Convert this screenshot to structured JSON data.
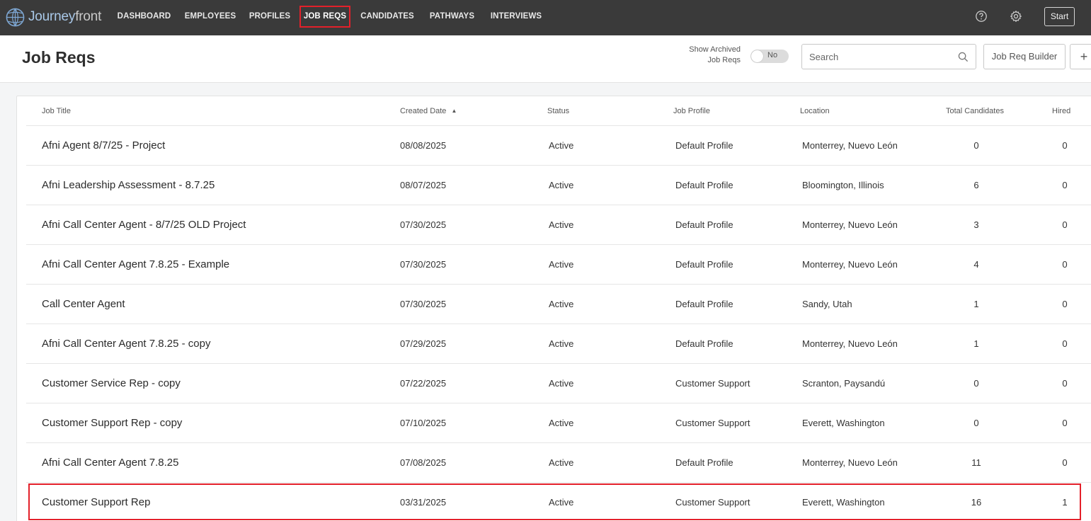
{
  "app": {
    "logo_primary": "Journey",
    "logo_secondary": "front"
  },
  "nav": {
    "items": [
      {
        "label": "DASHBOARD"
      },
      {
        "label": "EMPLOYEES"
      },
      {
        "label": "PROFILES"
      },
      {
        "label": "JOB REQS",
        "active": true
      },
      {
        "label": "CANDIDATES"
      },
      {
        "label": "PATHWAYS"
      },
      {
        "label": "INTERVIEWS"
      }
    ],
    "help_icon": "help-circle-icon",
    "settings_icon": "gear-icon",
    "start_label": "Start"
  },
  "header": {
    "title": "Job Reqs",
    "show_archived_line1": "Show Archived",
    "show_archived_line2": "Job Reqs",
    "toggle_value": "No",
    "search_placeholder": "Search",
    "builder_label": "Job Req Builder",
    "add_label": "+"
  },
  "table": {
    "columns": [
      "Job Title",
      "Created Date",
      "Status",
      "Job Profile",
      "Location",
      "Total Candidates",
      "Hired"
    ],
    "sort_column": "Created Date",
    "sort_indicator": "▲",
    "rows": [
      {
        "title": "Afni Agent 8/7/25 - Project",
        "created": "08/08/2025",
        "status": "Active",
        "profile": "Default Profile",
        "location": "Monterrey, Nuevo León",
        "total": "0",
        "hired": "0"
      },
      {
        "title": "Afni Leadership Assessment - 8.7.25",
        "created": "08/07/2025",
        "status": "Active",
        "profile": "Default Profile",
        "location": "Bloomington, Illinois",
        "total": "6",
        "hired": "0"
      },
      {
        "title": "Afni Call Center Agent - 8/7/25 OLD Project",
        "created": "07/30/2025",
        "status": "Active",
        "profile": "Default Profile",
        "location": "Monterrey, Nuevo León",
        "total": "3",
        "hired": "0"
      },
      {
        "title": "Afni Call Center Agent 7.8.25 - Example",
        "created": "07/30/2025",
        "status": "Active",
        "profile": "Default Profile",
        "location": "Monterrey, Nuevo León",
        "total": "4",
        "hired": "0"
      },
      {
        "title": "Call Center Agent",
        "created": "07/30/2025",
        "status": "Active",
        "profile": "Default Profile",
        "location": "Sandy, Utah",
        "total": "1",
        "hired": "0"
      },
      {
        "title": "Afni Call Center Agent 7.8.25 - copy",
        "created": "07/29/2025",
        "status": "Active",
        "profile": "Default Profile",
        "location": "Monterrey, Nuevo León",
        "total": "1",
        "hired": "0"
      },
      {
        "title": "Customer Service Rep - copy",
        "created": "07/22/2025",
        "status": "Active",
        "profile": "Customer Support",
        "location": "Scranton, Paysandú",
        "total": "0",
        "hired": "0"
      },
      {
        "title": "Customer Support Rep - copy",
        "created": "07/10/2025",
        "status": "Active",
        "profile": "Customer Support",
        "location": "Everett, Washington",
        "total": "0",
        "hired": "0"
      },
      {
        "title": "Afni Call Center Agent 7.8.25",
        "created": "07/08/2025",
        "status": "Active",
        "profile": "Default Profile",
        "location": "Monterrey, Nuevo León",
        "total": "11",
        "hired": "0"
      },
      {
        "title": "Customer Support Rep",
        "created": "03/31/2025",
        "status": "Active",
        "profile": "Customer Support",
        "location": "Everett, Washington",
        "total": "16",
        "hired": "1"
      }
    ]
  },
  "colors": {
    "nav_bg": "#3a3a3a",
    "highlight": "#e3202a",
    "logo_accent": "#a9c8e8"
  }
}
